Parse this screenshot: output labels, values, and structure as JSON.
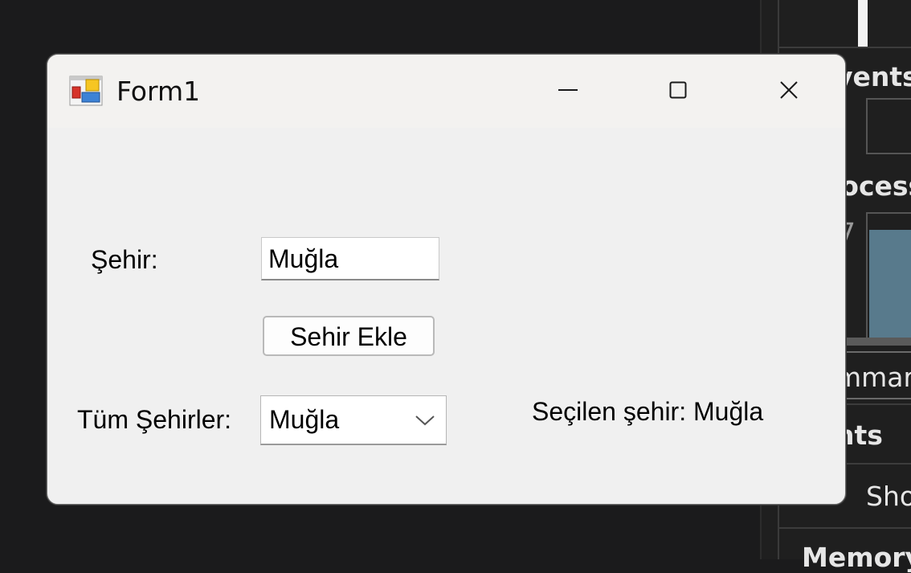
{
  "window": {
    "title": "Form1",
    "icon": "winforms-app-icon"
  },
  "caption_buttons": {
    "minimize_icon": "minimize-icon",
    "maximize_icon": "maximize-icon",
    "close_icon": "close-icon"
  },
  "form": {
    "city_label": "Şehir:",
    "city_input_value": "Muğla",
    "add_button_label": "Sehir Ekle",
    "all_cities_label": "Tüm Şehirler:",
    "all_cities_selected": "Muğla",
    "selected_city_label": "Seçilen şehir: Muğla"
  },
  "background": {
    "panel_text_1": "vents",
    "panel_text_2": "rocess",
    "panel_text_3": "7",
    "panel_text_4": "mmary",
    "panel_text_5": "nts",
    "panel_text_6": "Sho",
    "panel_text_7": "Memory"
  },
  "colors": {
    "window_bg": "#f0f0f0",
    "titlebar_bg": "#f3f2f0",
    "desktop_bg": "#1b1b1c",
    "chart_fill": "#587a8c"
  }
}
